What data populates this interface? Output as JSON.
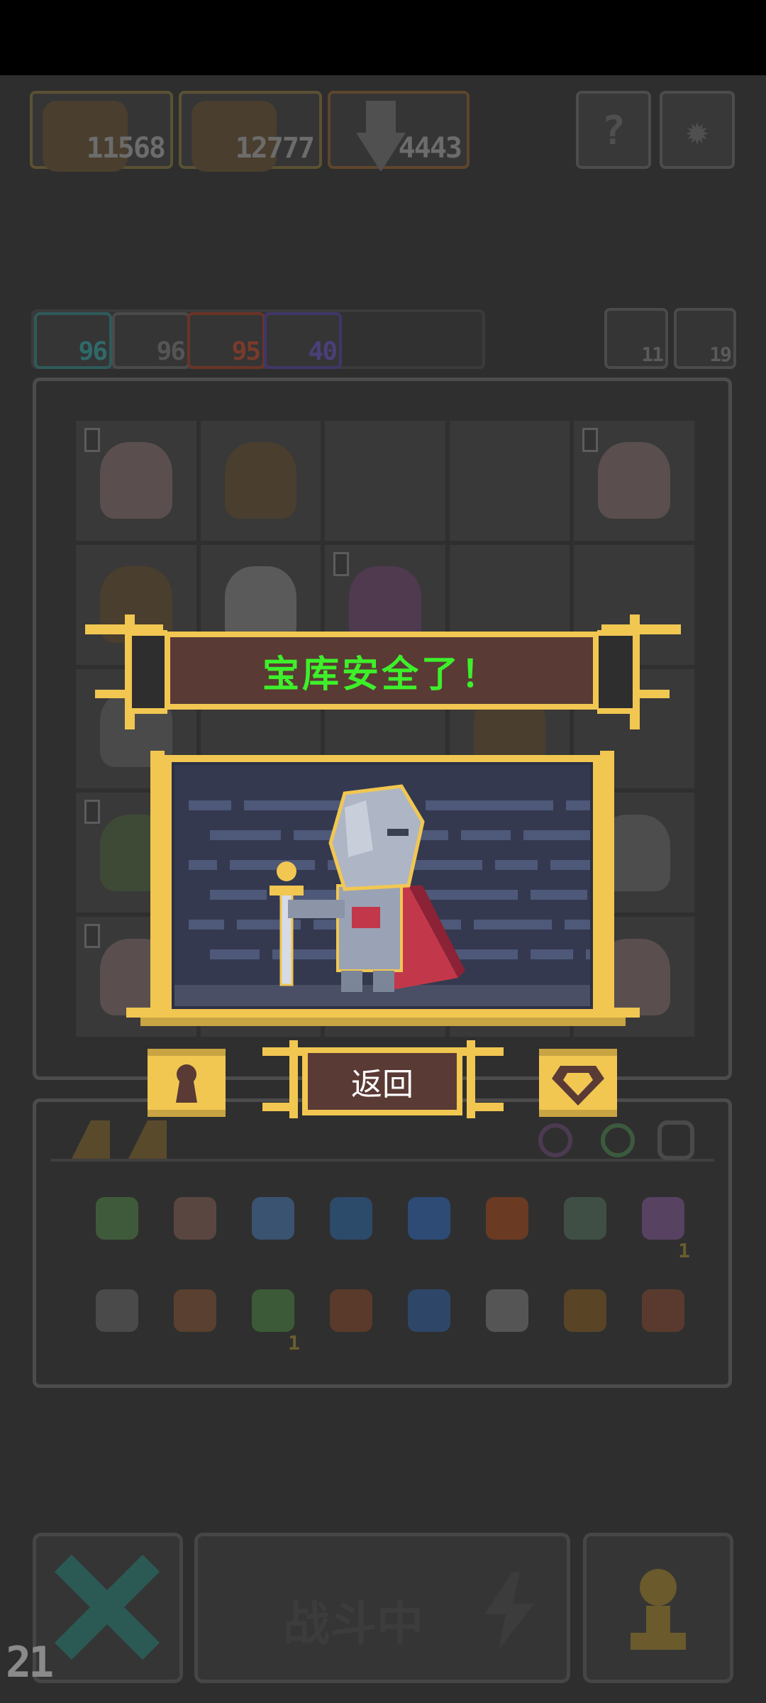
{
  "resources": [
    {
      "value": "11568",
      "icon": "monster-portrait-icon"
    },
    {
      "value": "12777",
      "icon": "monster-portrait-icon"
    },
    {
      "value": "4443",
      "icon": "shard-icon"
    }
  ],
  "header_buttons": [
    {
      "icon": "help-icon",
      "glyph": "?"
    },
    {
      "icon": "gear-icon",
      "glyph": "✹"
    }
  ],
  "stats": [
    {
      "value": "96",
      "icon": "at-spiral-icon",
      "color": "#2f6a6a"
    },
    {
      "value": "96",
      "icon": "mail-icon",
      "color": "#555555"
    },
    {
      "value": "95",
      "icon": "up-arrow-icon",
      "color": "#7a3a2a"
    },
    {
      "value": "40",
      "icon": "lightning-icon",
      "color": "#4b3f7a"
    }
  ],
  "counters": [
    {
      "value": "11",
      "icon": "tower-icon"
    },
    {
      "value": "19",
      "icon": "key-icon"
    }
  ],
  "modal": {
    "title": "宝库安全了！",
    "return_label": "返回",
    "left_icon": "keyhole-icon",
    "right_icon": "gem-icon",
    "colors": {
      "gold": "#f1c752",
      "panel": "#5a3a35",
      "title": "#3df02a"
    }
  },
  "board_levels": [
    "0",
    "",
    "",
    "",
    "0",
    "",
    "",
    "0",
    "",
    "",
    "",
    "",
    "",
    "",
    "",
    "0",
    "",
    "",
    "",
    "",
    "0",
    "",
    "",
    "",
    ""
  ],
  "inventory": {
    "items": [
      {
        "icon": "helmet-icon",
        "color": "#3f5a3a",
        "count": ""
      },
      {
        "icon": "hammer-icon",
        "color": "#5a4640",
        "count": ""
      },
      {
        "icon": "wind-icon",
        "color": "#3a5370",
        "count": ""
      },
      {
        "icon": "water-scroll-icon",
        "color": "#2c4a6a",
        "count": ""
      },
      {
        "icon": "drop-icon",
        "color": "#2d4b75",
        "count": ""
      },
      {
        "icon": "fire-scroll-icon",
        "color": "#6a3a22",
        "count": ""
      },
      {
        "icon": "phone-icon",
        "color": "#3f4f45",
        "count": ""
      },
      {
        "icon": "hourglass-icon",
        "color": "#574262",
        "count": "1"
      },
      {
        "icon": "shuriken-icon",
        "color": "#4a4a4a",
        "count": ""
      },
      {
        "icon": "wand-icon",
        "color": "#5a4030",
        "count": ""
      },
      {
        "icon": "vine-icon",
        "color": "#3d5a38",
        "count": "1"
      },
      {
        "icon": "mask-icon",
        "color": "#5a3a2a",
        "count": ""
      },
      {
        "icon": "ice-scroll-icon",
        "color": "#2e4668",
        "count": ""
      },
      {
        "icon": "tornado-icon",
        "color": "#555555",
        "count": ""
      },
      {
        "icon": "totem-icon",
        "color": "#5a4426",
        "count": ""
      },
      {
        "icon": "horn-icon",
        "color": "#5a3a2e",
        "count": ""
      }
    ]
  },
  "bottom": {
    "battle_label": "战斗中",
    "cancel_icon": "close-icon",
    "speed_icon": "lightning-icon",
    "hero_icon": "pawn-icon"
  },
  "fps": "21"
}
